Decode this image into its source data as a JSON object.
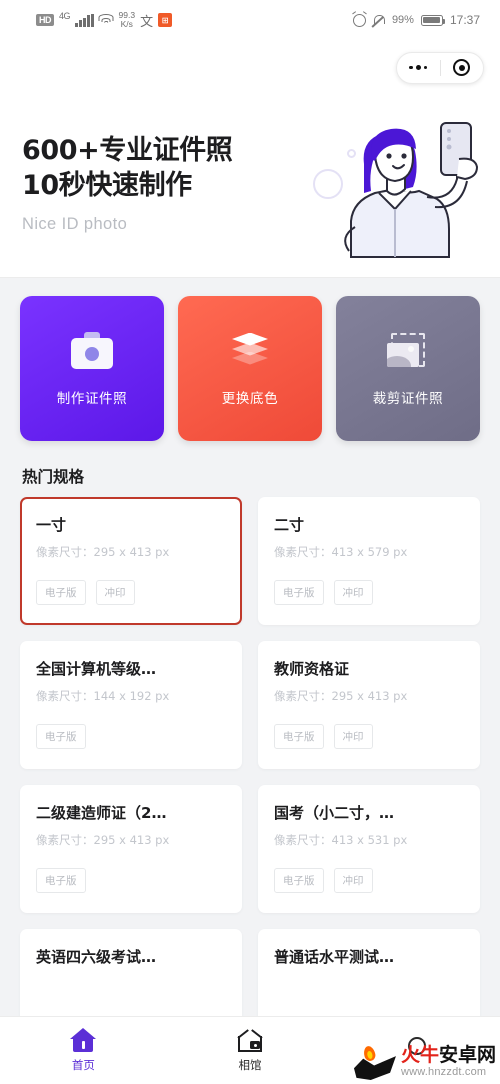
{
  "status_bar": {
    "hd_label": "HD",
    "network_type": "4G",
    "speed_value": "99.3",
    "speed_unit": "K/s",
    "input_method_glyph": "文",
    "app_badge_glyph": "⊞",
    "battery_percent": "99%",
    "time": "17:37",
    "icons": [
      "hd-icon",
      "signal-bars-icon",
      "wifi-icon",
      "network-speed",
      "input-method-icon",
      "app-badge-icon",
      "alarm-icon",
      "bell-muted-icon",
      "battery-icon"
    ]
  },
  "capsule": {
    "menu_icon": "more-dots-icon",
    "close_icon": "target-circle-icon"
  },
  "banner": {
    "title_line1": "600+专业证件照",
    "title_line2": "10秒快速制作",
    "subtitle": "Nice ID photo",
    "illustration": "woman-taking-selfie-illustration"
  },
  "actions": [
    {
      "label": "制作证件照",
      "icon": "camera-icon",
      "color": "#6821ef",
      "color2": "#5c18e8"
    },
    {
      "label": "更换底色",
      "icon": "layers-icon",
      "color": "#f95c4a",
      "color2": "#ef4a38"
    },
    {
      "label": "裁剪证件照",
      "icon": "crop-image-icon",
      "color": "#797791",
      "color2": "#6f6d87"
    }
  ],
  "specs_section": {
    "title": "热门规格",
    "size_prefix": "像素尺寸：",
    "items": [
      {
        "name": "一寸",
        "size": "295 x 413 px",
        "tags": [
          "电子版",
          "冲印"
        ],
        "selected": true
      },
      {
        "name": "二寸",
        "size": "413 x 579 px",
        "tags": [
          "电子版",
          "冲印"
        ],
        "selected": false
      },
      {
        "name": "全国计算机等级…",
        "size": "144 x 192 px",
        "tags": [
          "电子版"
        ],
        "selected": false
      },
      {
        "name": "教师资格证",
        "size": "295 x 413 px",
        "tags": [
          "电子版",
          "冲印"
        ],
        "selected": false
      },
      {
        "name": "二级建造师证（2…",
        "size": "295 x 413 px",
        "tags": [
          "电子版"
        ],
        "selected": false
      },
      {
        "name": "国考（小二寸，…",
        "size": "413 x 531 px",
        "tags": [
          "电子版",
          "冲印"
        ],
        "selected": false
      },
      {
        "name": "英语四六级考试…",
        "size": "",
        "tags": [],
        "selected": false
      },
      {
        "name": "普通话水平测试…",
        "size": "",
        "tags": [],
        "selected": false
      }
    ]
  },
  "tabbar": {
    "items": [
      {
        "label": "首页",
        "icon": "home-icon",
        "active": true
      },
      {
        "label": "相馆",
        "icon": "photo-studio-icon",
        "active": false
      },
      {
        "label": "",
        "icon": "profile-icon",
        "active": false
      }
    ]
  },
  "watermark": {
    "name_red": "火牛",
    "name_black": "安卓网",
    "url": "www.hnzzdt.com"
  },
  "colors": {
    "accent_purple": "#5b2fd6",
    "card_purple": "#6821ef",
    "card_red": "#f95c4a",
    "card_gray": "#797791",
    "selected_border": "#c0392b",
    "page_bg": "#f2f3f5"
  }
}
